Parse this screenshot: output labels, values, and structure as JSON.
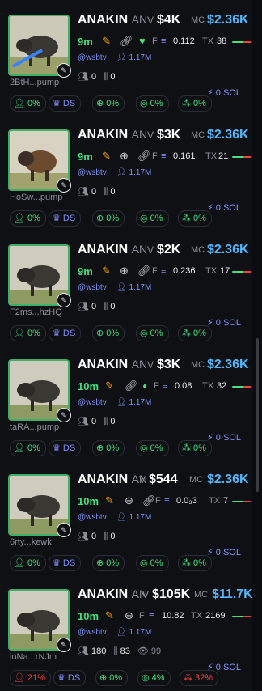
{
  "cards": [
    {
      "address": "2BtH...pump",
      "name": "ANAKIN",
      "symbol": "AN",
      "v_label": "V",
      "volume": "$4K",
      "mc_label": "MC",
      "mc": "$2.36K",
      "age": "9m",
      "f_label": "F",
      "f_value": "0.112",
      "tx_label": "TX",
      "tx_value": "38",
      "handle": "@wsbtv",
      "followers": "1.17M",
      "holders": "0",
      "pro": "0",
      "sol": "0 SOL",
      "stats": [
        "0%",
        "DS",
        "0%",
        "0%",
        "0%"
      ]
    },
    {
      "address": "HoSw...pump",
      "name": "ANAKIN",
      "symbol": "AN",
      "v_label": "V",
      "volume": "$3K",
      "mc_label": "MC",
      "mc": "$2.36K",
      "age": "9m",
      "f_label": "F",
      "f_value": "0.161",
      "tx_label": "TX",
      "tx_value": "21",
      "handle": "@wsbtv",
      "followers": "1.17M",
      "holders": "0",
      "pro": "0",
      "sol": "0 SOL",
      "stats": [
        "0%",
        "DS",
        "0%",
        "0%",
        "0%"
      ]
    },
    {
      "address": "F2ms...hzHQ",
      "name": "ANAKIN",
      "symbol": "AN",
      "v_label": "V",
      "volume": "$2K",
      "mc_label": "MC",
      "mc": "$2.36K",
      "age": "9m",
      "f_label": "F",
      "f_value": "0.236",
      "tx_label": "TX",
      "tx_value": "17",
      "handle": "@wsbtv",
      "followers": "1.17M",
      "holders": "0",
      "pro": "0",
      "sol": "0 SOL",
      "stats": [
        "0%",
        "DS",
        "0%",
        "0%",
        "0%"
      ]
    },
    {
      "address": "taRA...pump",
      "name": "ANAKIN",
      "symbol": "AN",
      "v_label": "V",
      "volume": "$3K",
      "mc_label": "MC",
      "mc": "$2.36K",
      "age": "10m",
      "f_label": "F",
      "f_value": "0.08",
      "tx_label": "TX",
      "tx_value": "32",
      "handle": "@wsbtv",
      "followers": "1.17M",
      "holders": "0",
      "pro": "0",
      "sol": "0 SOL",
      "stats": [
        "0%",
        "DS",
        "0%",
        "0%",
        "0%"
      ]
    },
    {
      "address": "6rty...kewk",
      "name": "ANAKIN",
      "symbol": "AN",
      "v_label": "V",
      "volume": "$544",
      "mc_label": "MC",
      "mc": "$2.36K",
      "age": "10m",
      "f_label": "F",
      "f_value": "0.0₃3",
      "tx_label": "TX",
      "tx_value": "7",
      "handle": "@wsbtv",
      "followers": "1.17M",
      "holders": "0",
      "pro": "0",
      "sol": "0 SOL",
      "stats": [
        "0%",
        "DS",
        "0%",
        "0%",
        "0%"
      ]
    },
    {
      "address": "ioNa...rNJm",
      "name": "ANAKIN",
      "symbol": "AN",
      "v_label": "V",
      "volume": "$105K",
      "mc_label": "MC",
      "mc": "$11.7K",
      "age": "10m",
      "f_label": "F",
      "f_value": "10.82",
      "tx_label": "TX",
      "tx_value": "2169",
      "handle": "@wsbtv",
      "followers": "1.17M",
      "holders": "180",
      "pro": "83",
      "views": "99",
      "sol": "0 SOL",
      "stats": [
        "21%",
        "DS",
        "0%",
        "4%",
        "32%"
      ]
    }
  ],
  "colors": {
    "accent_green": "#4ade80",
    "accent_blue": "#58b6f6",
    "accent_purple": "#7d8ef7",
    "accent_red": "#ef4444"
  }
}
